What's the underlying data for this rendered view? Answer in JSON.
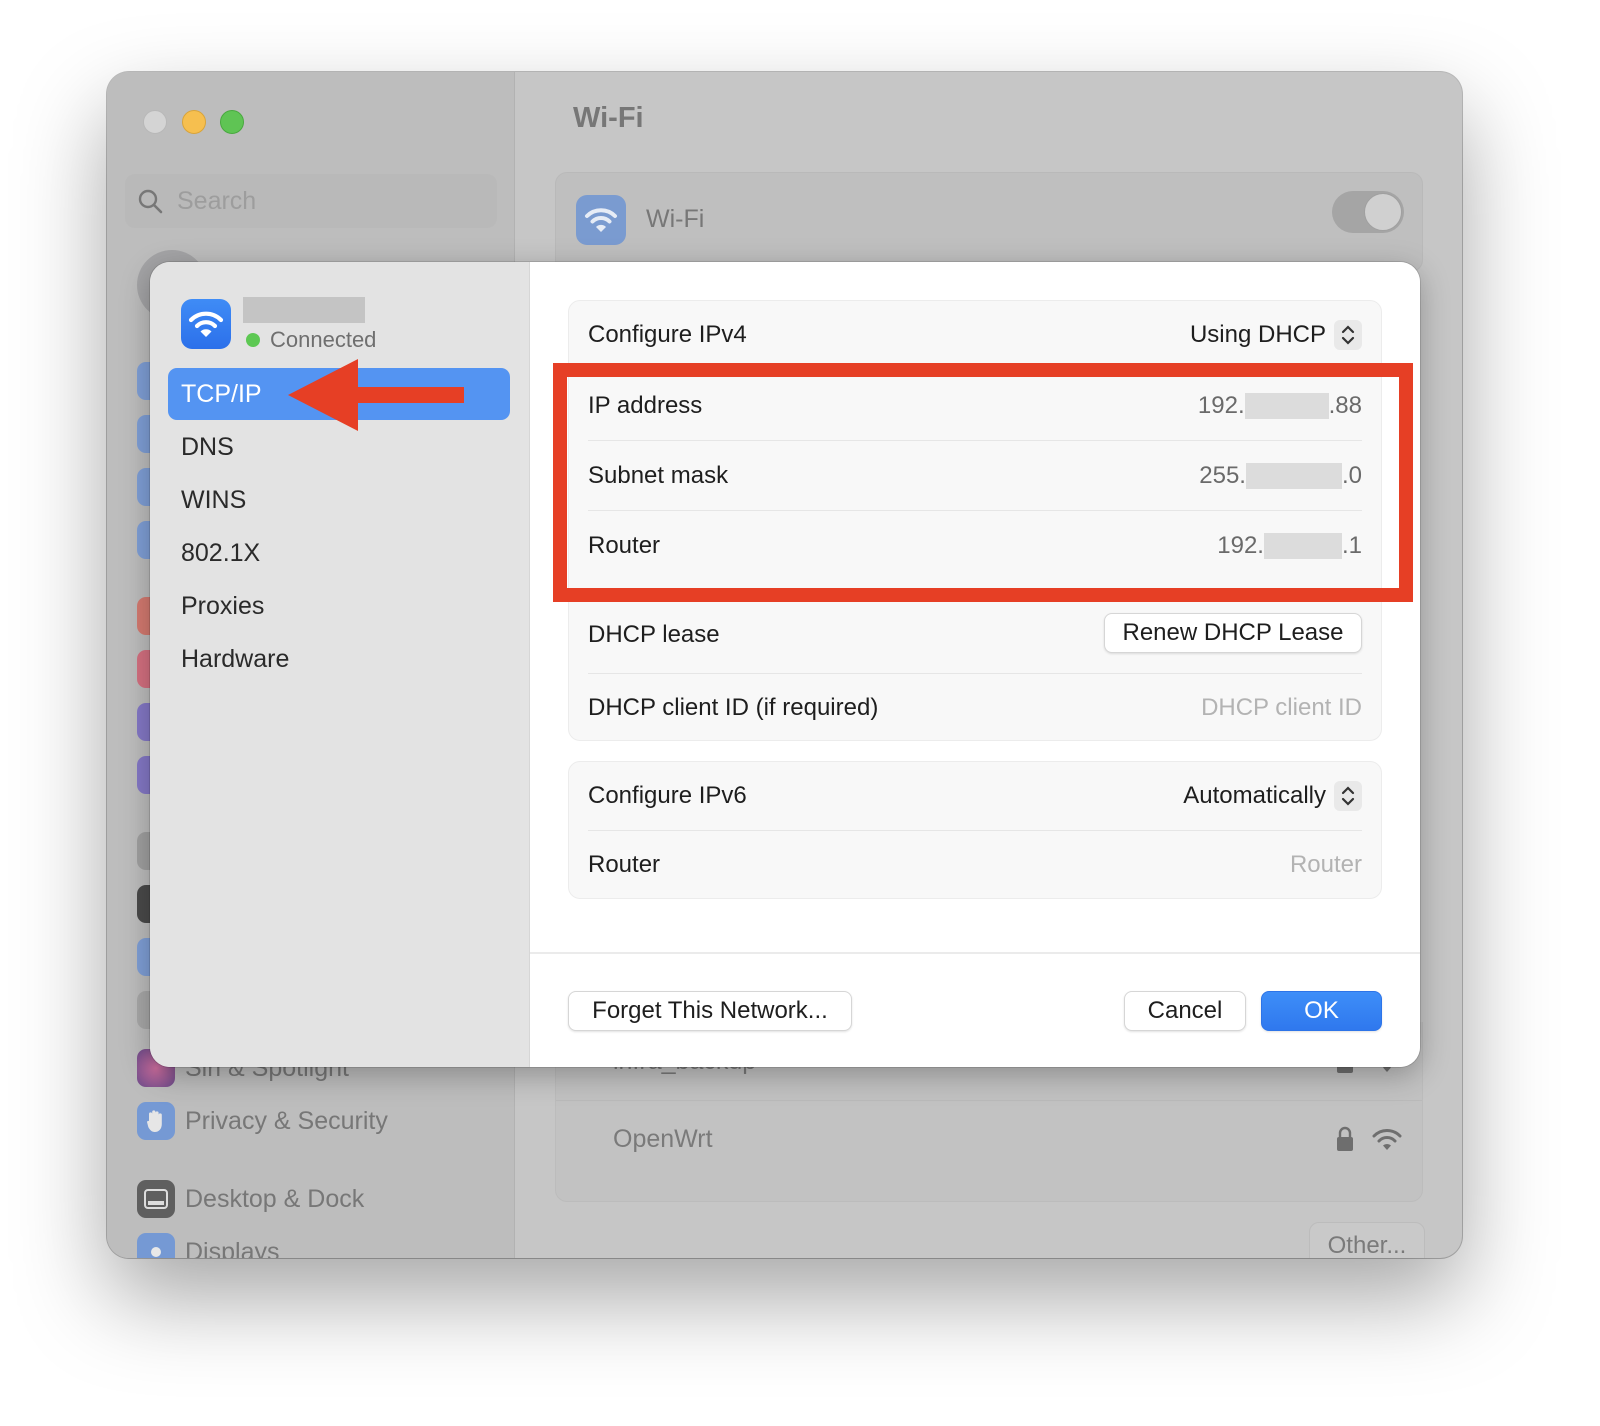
{
  "window": {
    "traffic_lights": [
      "close",
      "minimize",
      "zoom"
    ],
    "search": {
      "placeholder": "Search",
      "icon": "search-icon"
    },
    "sidebar_visible_items": [
      {
        "label": "Siri & Spotlight",
        "icon": "siri-icon",
        "color": "#a35a7a"
      },
      {
        "label": "Privacy & Security",
        "icon": "hand-icon",
        "color": "#7599d4"
      },
      {
        "label": "Desktop & Dock",
        "icon": "dock-icon",
        "color": "#5f5f5f"
      },
      {
        "label": "Displays",
        "icon": "sun-icon",
        "color": "#7599d4"
      }
    ],
    "main_title": "Wi-Fi",
    "wifi_toggle": {
      "label": "Wi-Fi",
      "on": false
    },
    "networks": [
      {
        "name": "infra_backup",
        "locked": true
      },
      {
        "name": "OpenWrt",
        "locked": true
      }
    ],
    "other_button": "Other..."
  },
  "sheet": {
    "network": {
      "name_redacted": true,
      "status": "Connected",
      "status_color": "#5dc853"
    },
    "tabs": [
      {
        "label": "TCP/IP",
        "active": true
      },
      {
        "label": "DNS",
        "active": false
      },
      {
        "label": "WINS",
        "active": false
      },
      {
        "label": "802.1X",
        "active": false
      },
      {
        "label": "Proxies",
        "active": false
      },
      {
        "label": "Hardware",
        "active": false
      }
    ],
    "ipv4": {
      "configure_label": "Configure IPv4",
      "configure_value": "Using DHCP",
      "ip_label": "IP address",
      "ip_prefix": "192.",
      "ip_suffix": ".88",
      "subnet_label": "Subnet mask",
      "subnet_prefix": "255.",
      "subnet_suffix": ".0",
      "router_label": "Router",
      "router_prefix": "192.",
      "router_suffix": ".1",
      "dhcp_lease_label": "DHCP lease",
      "renew_button": "Renew DHCP Lease",
      "client_id_label": "DHCP client ID (if required)",
      "client_id_placeholder": "DHCP client ID"
    },
    "ipv6": {
      "configure_label": "Configure IPv6",
      "configure_value": "Automatically",
      "router_label": "Router",
      "router_placeholder": "Router"
    },
    "footer": {
      "forget_button": "Forget This Network...",
      "cancel_button": "Cancel",
      "ok_button": "OK"
    }
  },
  "annotations": {
    "arrow_color": "#e63f25",
    "highlight_color": "#e63f25",
    "arrow_target": "TCP/IP",
    "highlighted_rows": [
      "IP address",
      "Subnet mask",
      "Router"
    ]
  }
}
